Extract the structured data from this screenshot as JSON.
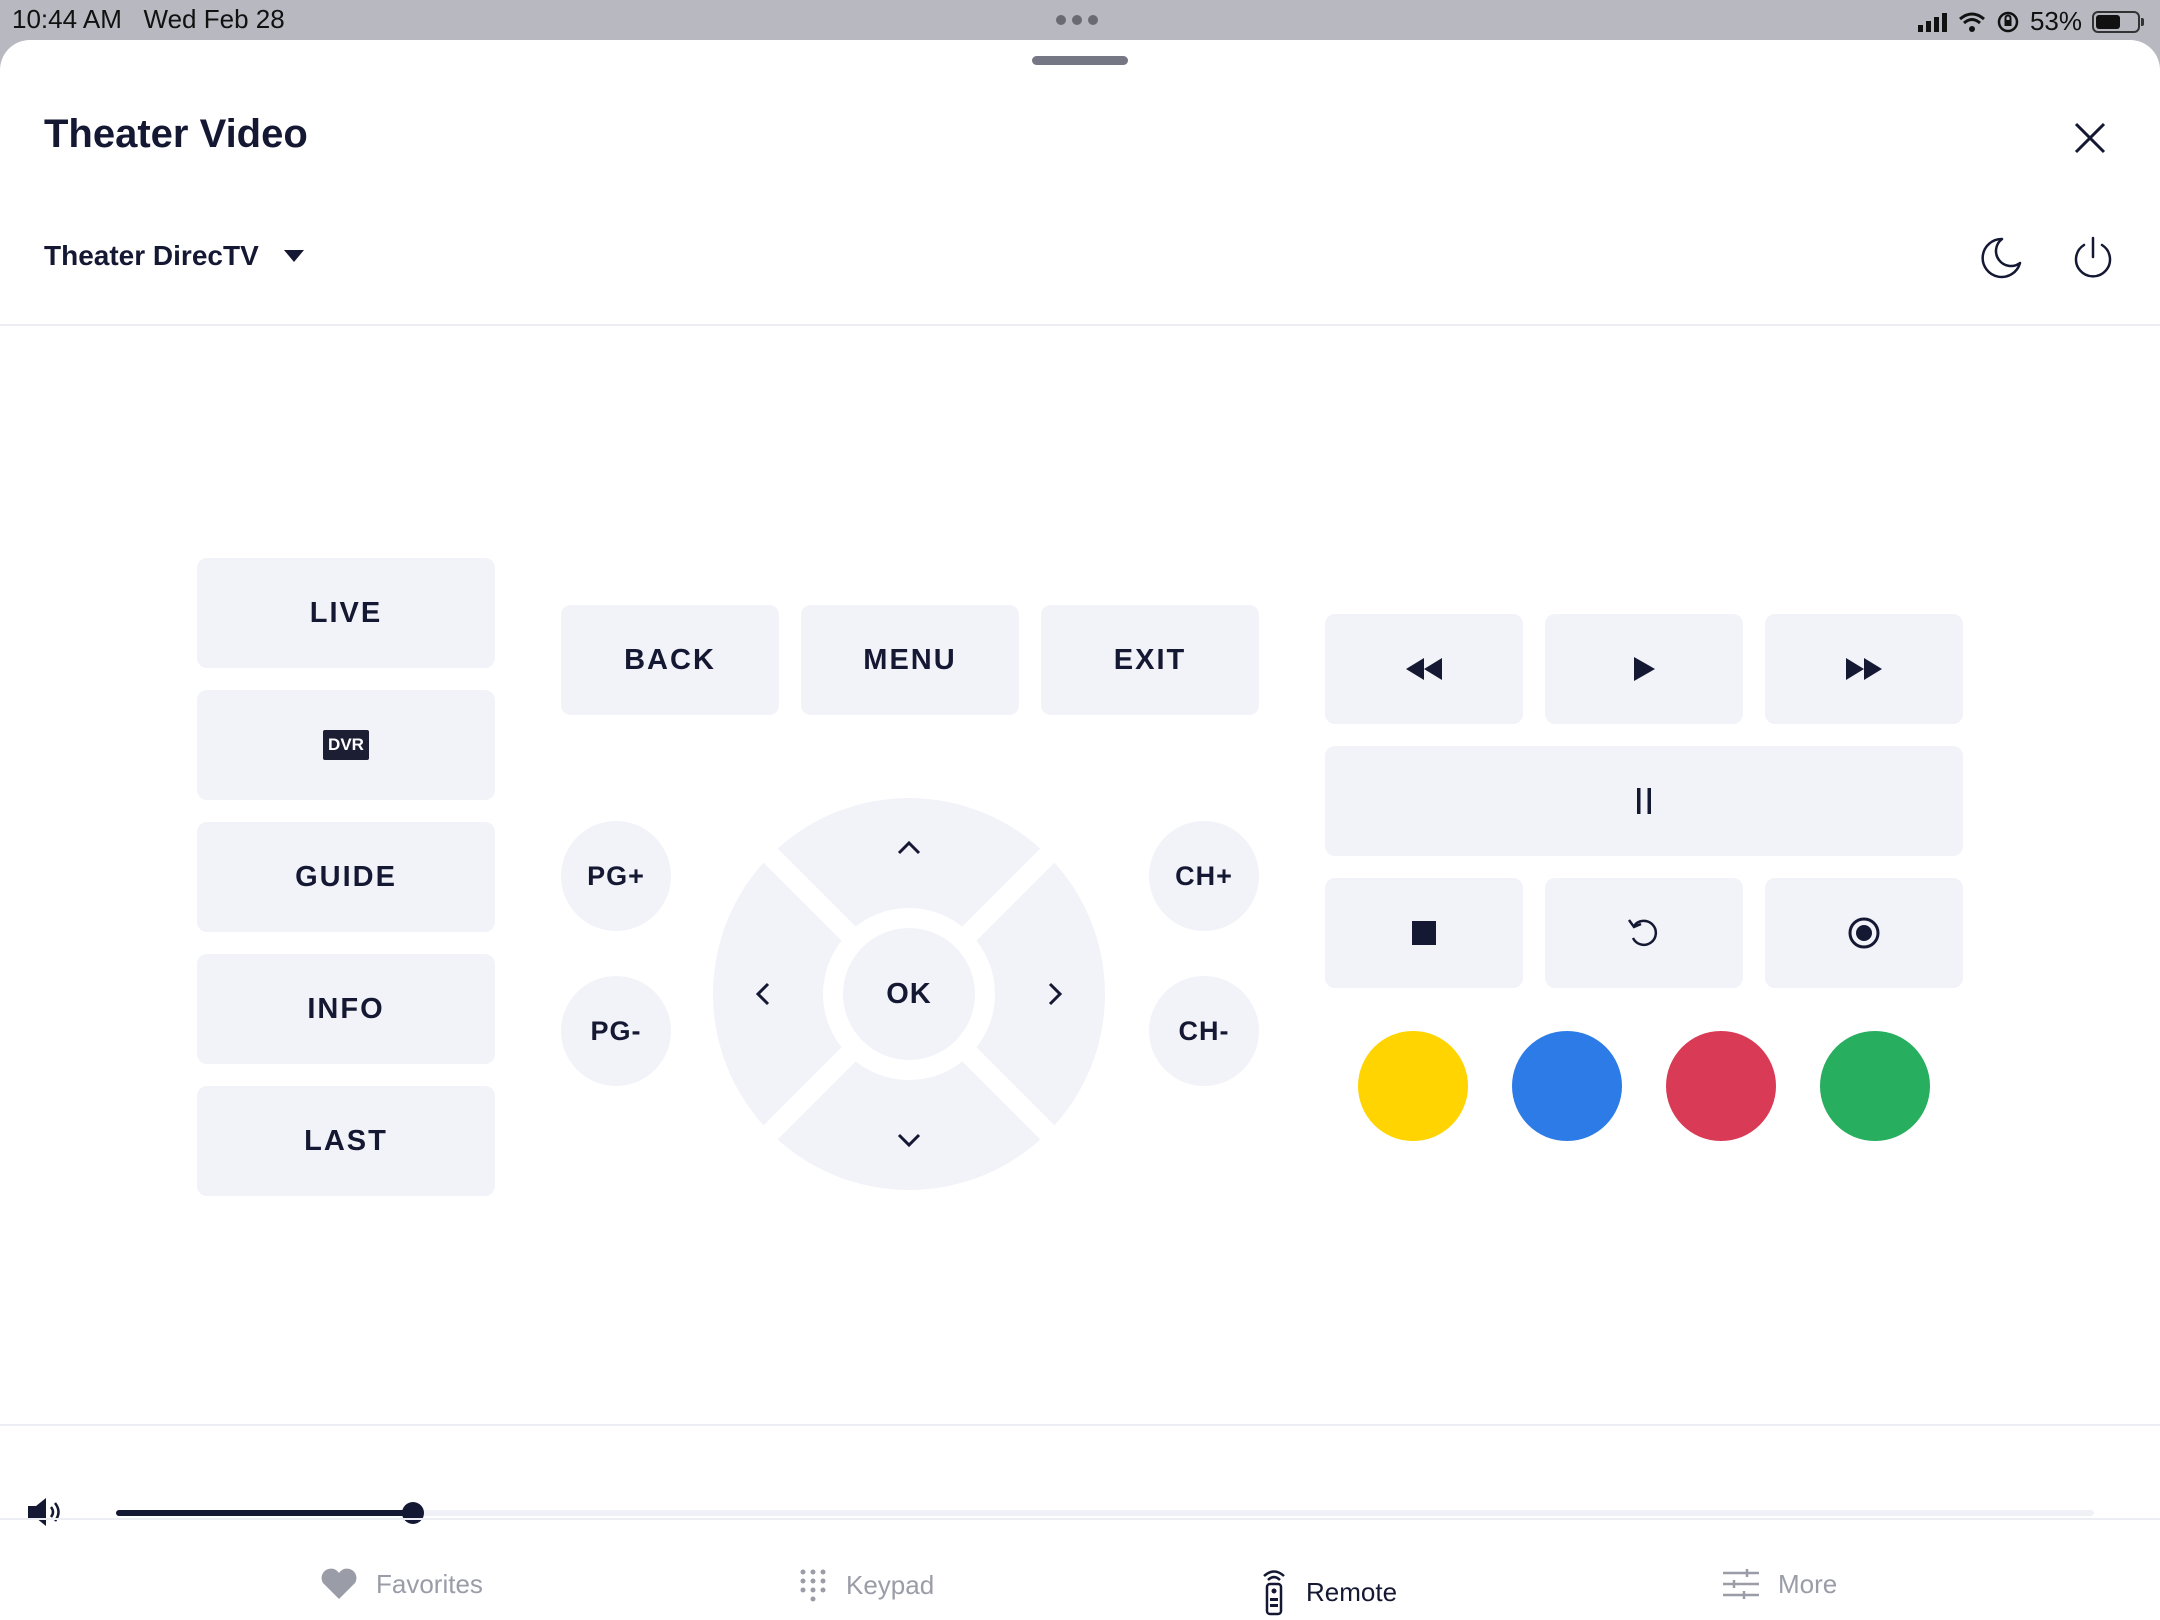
{
  "status_bar": {
    "time": "10:44 AM",
    "date": "Wed Feb 28",
    "battery": "53%",
    "battery_level": 0.53
  },
  "header": {
    "title": "Theater Video",
    "device": "Theater DirecTV"
  },
  "left_buttons": [
    "LIVE",
    "DVR",
    "GUIDE",
    "INFO",
    "LAST"
  ],
  "top_buttons": {
    "back": "BACK",
    "menu": "MENU",
    "exit": "EXIT"
  },
  "nav": {
    "ok": "OK",
    "page_up": "PG+",
    "page_down": "PG-",
    "channel_up": "CH+",
    "channel_down": "CH-"
  },
  "transport_icons": [
    "rewind-icon",
    "play-icon",
    "fast-forward-icon",
    "pause-icon",
    "stop-icon",
    "replay-icon",
    "record-icon"
  ],
  "color_buttons": {
    "yellow": "#FFD400",
    "blue": "#2D7BE6",
    "red": "#D93A55",
    "green": "#27AE5E"
  },
  "volume": {
    "level": 0.15
  },
  "tabs": [
    {
      "label": "Favorites",
      "icon": "heart-icon",
      "active": false
    },
    {
      "label": "Keypad",
      "icon": "keypad-icon",
      "active": false
    },
    {
      "label": "Remote",
      "icon": "remote-icon",
      "active": true
    },
    {
      "label": "More",
      "icon": "sliders-icon",
      "active": false
    }
  ],
  "colors": {
    "accent": "#151833",
    "button_bg": "#F2F3F8"
  }
}
